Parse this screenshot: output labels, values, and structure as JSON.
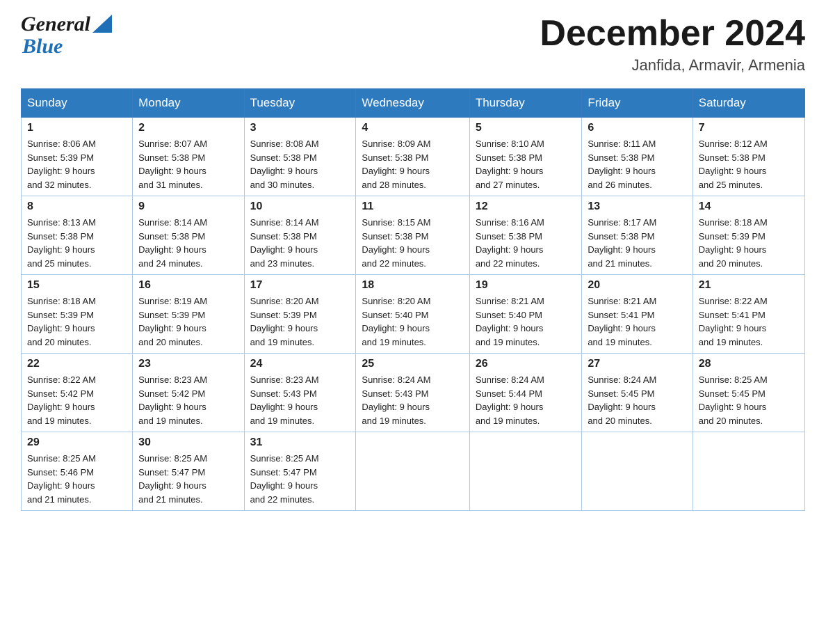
{
  "header": {
    "logo_general": "General",
    "logo_blue": "Blue",
    "month_title": "December 2024",
    "location": "Janfida, Armavir, Armenia"
  },
  "days_of_week": [
    "Sunday",
    "Monday",
    "Tuesday",
    "Wednesday",
    "Thursday",
    "Friday",
    "Saturday"
  ],
  "weeks": [
    [
      {
        "day": "1",
        "sunrise": "8:06 AM",
        "sunset": "5:39 PM",
        "daylight": "9 hours and 32 minutes."
      },
      {
        "day": "2",
        "sunrise": "8:07 AM",
        "sunset": "5:38 PM",
        "daylight": "9 hours and 31 minutes."
      },
      {
        "day": "3",
        "sunrise": "8:08 AM",
        "sunset": "5:38 PM",
        "daylight": "9 hours and 30 minutes."
      },
      {
        "day": "4",
        "sunrise": "8:09 AM",
        "sunset": "5:38 PM",
        "daylight": "9 hours and 28 minutes."
      },
      {
        "day": "5",
        "sunrise": "8:10 AM",
        "sunset": "5:38 PM",
        "daylight": "9 hours and 27 minutes."
      },
      {
        "day": "6",
        "sunrise": "8:11 AM",
        "sunset": "5:38 PM",
        "daylight": "9 hours and 26 minutes."
      },
      {
        "day": "7",
        "sunrise": "8:12 AM",
        "sunset": "5:38 PM",
        "daylight": "9 hours and 25 minutes."
      }
    ],
    [
      {
        "day": "8",
        "sunrise": "8:13 AM",
        "sunset": "5:38 PM",
        "daylight": "9 hours and 25 minutes."
      },
      {
        "day": "9",
        "sunrise": "8:14 AM",
        "sunset": "5:38 PM",
        "daylight": "9 hours and 24 minutes."
      },
      {
        "day": "10",
        "sunrise": "8:14 AM",
        "sunset": "5:38 PM",
        "daylight": "9 hours and 23 minutes."
      },
      {
        "day": "11",
        "sunrise": "8:15 AM",
        "sunset": "5:38 PM",
        "daylight": "9 hours and 22 minutes."
      },
      {
        "day": "12",
        "sunrise": "8:16 AM",
        "sunset": "5:38 PM",
        "daylight": "9 hours and 22 minutes."
      },
      {
        "day": "13",
        "sunrise": "8:17 AM",
        "sunset": "5:38 PM",
        "daylight": "9 hours and 21 minutes."
      },
      {
        "day": "14",
        "sunrise": "8:18 AM",
        "sunset": "5:39 PM",
        "daylight": "9 hours and 20 minutes."
      }
    ],
    [
      {
        "day": "15",
        "sunrise": "8:18 AM",
        "sunset": "5:39 PM",
        "daylight": "9 hours and 20 minutes."
      },
      {
        "day": "16",
        "sunrise": "8:19 AM",
        "sunset": "5:39 PM",
        "daylight": "9 hours and 20 minutes."
      },
      {
        "day": "17",
        "sunrise": "8:20 AM",
        "sunset": "5:39 PM",
        "daylight": "9 hours and 19 minutes."
      },
      {
        "day": "18",
        "sunrise": "8:20 AM",
        "sunset": "5:40 PM",
        "daylight": "9 hours and 19 minutes."
      },
      {
        "day": "19",
        "sunrise": "8:21 AM",
        "sunset": "5:40 PM",
        "daylight": "9 hours and 19 minutes."
      },
      {
        "day": "20",
        "sunrise": "8:21 AM",
        "sunset": "5:41 PM",
        "daylight": "9 hours and 19 minutes."
      },
      {
        "day": "21",
        "sunrise": "8:22 AM",
        "sunset": "5:41 PM",
        "daylight": "9 hours and 19 minutes."
      }
    ],
    [
      {
        "day": "22",
        "sunrise": "8:22 AM",
        "sunset": "5:42 PM",
        "daylight": "9 hours and 19 minutes."
      },
      {
        "day": "23",
        "sunrise": "8:23 AM",
        "sunset": "5:42 PM",
        "daylight": "9 hours and 19 minutes."
      },
      {
        "day": "24",
        "sunrise": "8:23 AM",
        "sunset": "5:43 PM",
        "daylight": "9 hours and 19 minutes."
      },
      {
        "day": "25",
        "sunrise": "8:24 AM",
        "sunset": "5:43 PM",
        "daylight": "9 hours and 19 minutes."
      },
      {
        "day": "26",
        "sunrise": "8:24 AM",
        "sunset": "5:44 PM",
        "daylight": "9 hours and 19 minutes."
      },
      {
        "day": "27",
        "sunrise": "8:24 AM",
        "sunset": "5:45 PM",
        "daylight": "9 hours and 20 minutes."
      },
      {
        "day": "28",
        "sunrise": "8:25 AM",
        "sunset": "5:45 PM",
        "daylight": "9 hours and 20 minutes."
      }
    ],
    [
      {
        "day": "29",
        "sunrise": "8:25 AM",
        "sunset": "5:46 PM",
        "daylight": "9 hours and 21 minutes."
      },
      {
        "day": "30",
        "sunrise": "8:25 AM",
        "sunset": "5:47 PM",
        "daylight": "9 hours and 21 minutes."
      },
      {
        "day": "31",
        "sunrise": "8:25 AM",
        "sunset": "5:47 PM",
        "daylight": "9 hours and 22 minutes."
      },
      null,
      null,
      null,
      null
    ]
  ],
  "labels": {
    "sunrise": "Sunrise:",
    "sunset": "Sunset:",
    "daylight": "Daylight:"
  }
}
